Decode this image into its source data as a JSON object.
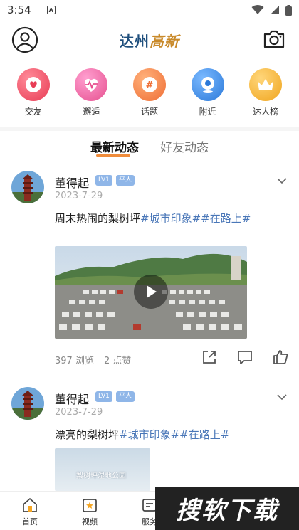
{
  "status_bar": {
    "time": "3:54",
    "notif_letter": "A"
  },
  "header": {
    "logo_part1": "达州",
    "logo_part2": "高新"
  },
  "categories": [
    {
      "label": "交友",
      "color": "#f0566b",
      "icon": "heart-icon"
    },
    {
      "label": "邂逅",
      "color": "#f06fb0",
      "icon": "heartbeat-icon"
    },
    {
      "label": "话题",
      "color": "#f48a4a",
      "icon": "hashtag-icon"
    },
    {
      "label": "附近",
      "color": "#3d8fe8",
      "icon": "location-icon"
    },
    {
      "label": "达人榜",
      "color": "#f5b436",
      "icon": "crown-icon"
    }
  ],
  "tabs": [
    {
      "label": "最新动态",
      "active": true
    },
    {
      "label": "好友动态",
      "active": false
    }
  ],
  "posts": [
    {
      "name": "董得起",
      "badges": [
        "LV1",
        "平人"
      ],
      "date": "2023-7-29",
      "text": "周末热闹的梨树坪",
      "tags": "#城市印象##在路上#",
      "views": "397 浏览",
      "likes": "2 点赞"
    },
    {
      "name": "董得起",
      "badges": [
        "LV1",
        "平人"
      ],
      "date": "2023-7-29",
      "text": "漂亮的梨树坪",
      "tags": "#城市印象##在路上#",
      "image_caption": "梨树坪湿地公园"
    }
  ],
  "bottom_nav": [
    {
      "label": "首页",
      "icon": "home-icon"
    },
    {
      "label": "视频",
      "icon": "video-star-icon"
    },
    {
      "label": "服务",
      "icon": "service-icon"
    },
    {
      "label": "",
      "icon": ""
    },
    {
      "label": "",
      "icon": ""
    }
  ],
  "watermark": "搜软下载",
  "colors": {
    "accent": "#f08c3b",
    "tag": "#4a77b8",
    "badge": "#8fb6e8"
  }
}
